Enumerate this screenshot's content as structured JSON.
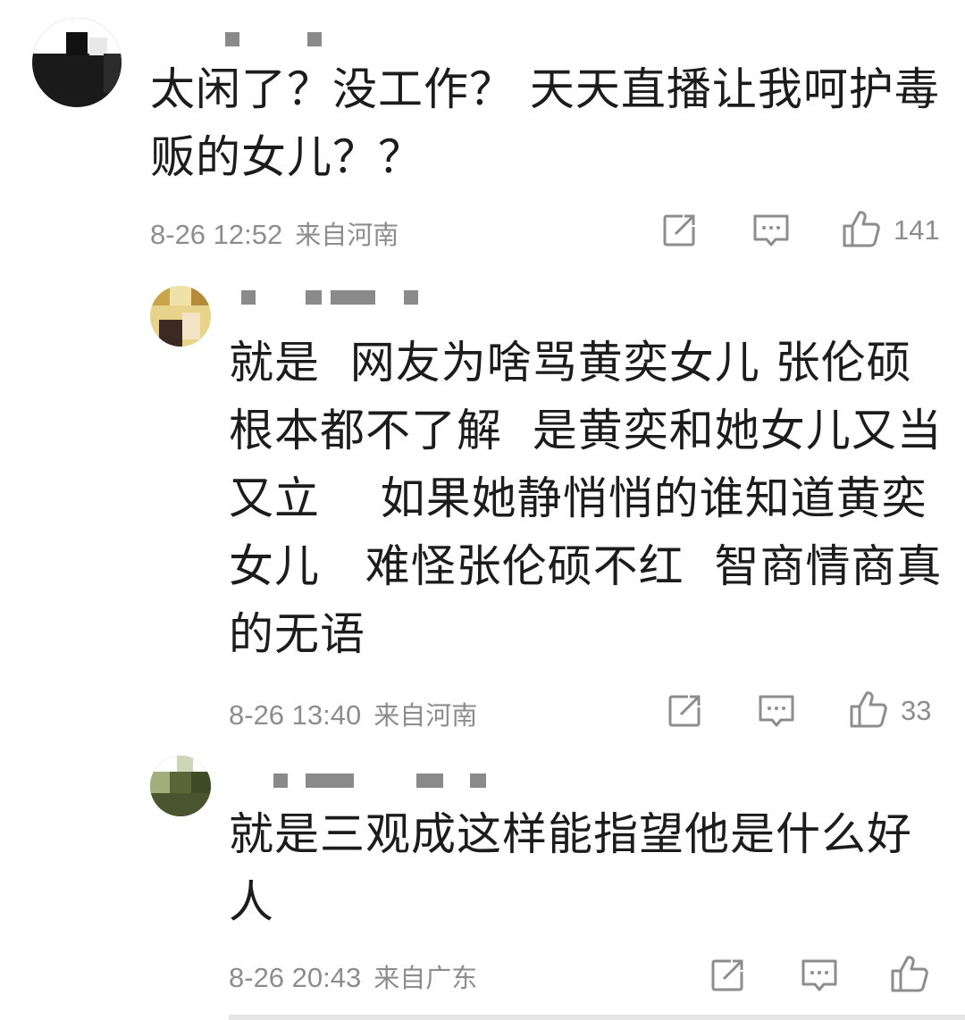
{
  "comments": [
    {
      "text": "太闲了？没工作？ 天天直播让我呵护毒贩的女儿？？",
      "date": "8-26 12:52",
      "location": "来自河南",
      "likes": "141",
      "icons": {
        "share": "share-icon",
        "reply": "comment-icon",
        "like": "thumbs-up-icon"
      }
    },
    {
      "text": "就是  网友为啥骂黄奕女儿 张伦硕根本都不了解  是黄奕和她女儿又当又立    如果她静悄悄的谁知道黄奕女儿   难怪张伦硕不红  智商情商真的无语",
      "date": "8-26 13:40",
      "location": "来自河南",
      "likes": "33",
      "icons": {
        "share": "share-icon",
        "reply": "comment-icon",
        "like": "thumbs-up-icon"
      }
    },
    {
      "text": "就是三观成这样能指望他是什么好人",
      "date": "8-26 20:43",
      "location": "来自广东",
      "likes": "",
      "icons": {
        "share": "share-icon",
        "reply": "comment-icon",
        "like": "thumbs-up-icon"
      }
    }
  ],
  "colors": {
    "text": "#1c1c1c",
    "meta": "#8d8d8d",
    "icon": "#8d8d8d"
  }
}
